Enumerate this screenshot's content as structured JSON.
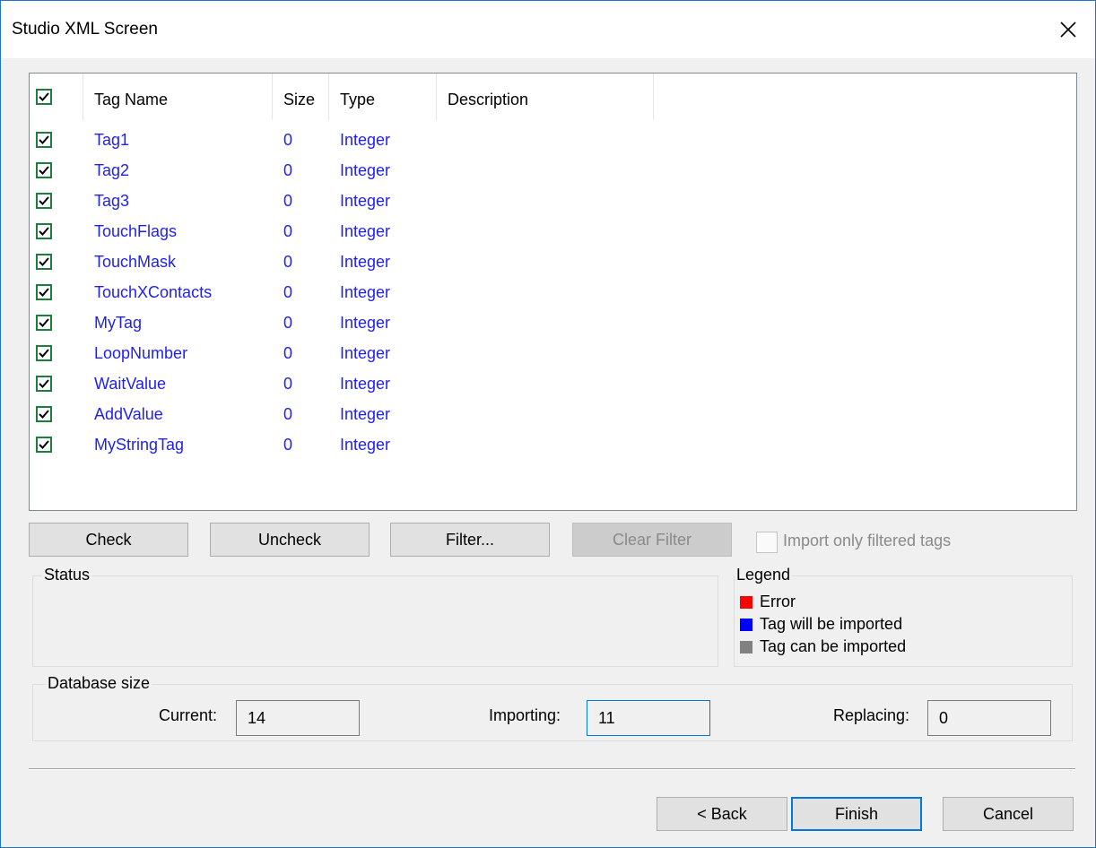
{
  "window": {
    "title": "Studio XML Screen"
  },
  "list": {
    "columns": [
      "Tag Name",
      "Size",
      "Type",
      "Description"
    ],
    "rows": [
      {
        "name": "Tag1",
        "size": "0",
        "type": "Integer",
        "description": "",
        "checked": true
      },
      {
        "name": "Tag2",
        "size": "0",
        "type": "Integer",
        "description": "",
        "checked": true
      },
      {
        "name": "Tag3",
        "size": "0",
        "type": "Integer",
        "description": "",
        "checked": true
      },
      {
        "name": "TouchFlags",
        "size": "0",
        "type": "Integer",
        "description": "",
        "checked": true
      },
      {
        "name": "TouchMask",
        "size": "0",
        "type": "Integer",
        "description": "",
        "checked": true
      },
      {
        "name": "TouchXContacts",
        "size": "0",
        "type": "Integer",
        "description": "",
        "checked": true
      },
      {
        "name": "MyTag",
        "size": "0",
        "type": "Integer",
        "description": "",
        "checked": true
      },
      {
        "name": "LoopNumber",
        "size": "0",
        "type": "Integer",
        "description": "",
        "checked": true
      },
      {
        "name": "WaitValue",
        "size": "0",
        "type": "Integer",
        "description": "",
        "checked": true
      },
      {
        "name": "AddValue",
        "size": "0",
        "type": "Integer",
        "description": "",
        "checked": true
      },
      {
        "name": "MyStringTag",
        "size": "0",
        "type": "Integer",
        "description": "",
        "checked": true
      }
    ]
  },
  "actions": {
    "check": "Check",
    "uncheck": "Uncheck",
    "filter": "Filter...",
    "clear_filter": "Clear Filter",
    "import_filtered": "Import only filtered tags"
  },
  "status": {
    "title": "Status"
  },
  "legend": {
    "title": "Legend",
    "items": [
      {
        "label": "Error",
        "color": "#ff0000"
      },
      {
        "label": "Tag will be imported",
        "color": "#0000ff"
      },
      {
        "label": "Tag can be imported",
        "color": "#808080"
      }
    ]
  },
  "database": {
    "title": "Database size",
    "current_label": "Current:",
    "current_value": "14",
    "importing_label": "Importing:",
    "importing_value": "11",
    "replacing_label": "Replacing:",
    "replacing_value": "0"
  },
  "footer": {
    "back": "< Back",
    "finish": "Finish",
    "cancel": "Cancel"
  },
  "colors": {
    "tag_text": "#1f1ff0",
    "accent": "#0078d7",
    "check_green": "#1a7f3c"
  }
}
